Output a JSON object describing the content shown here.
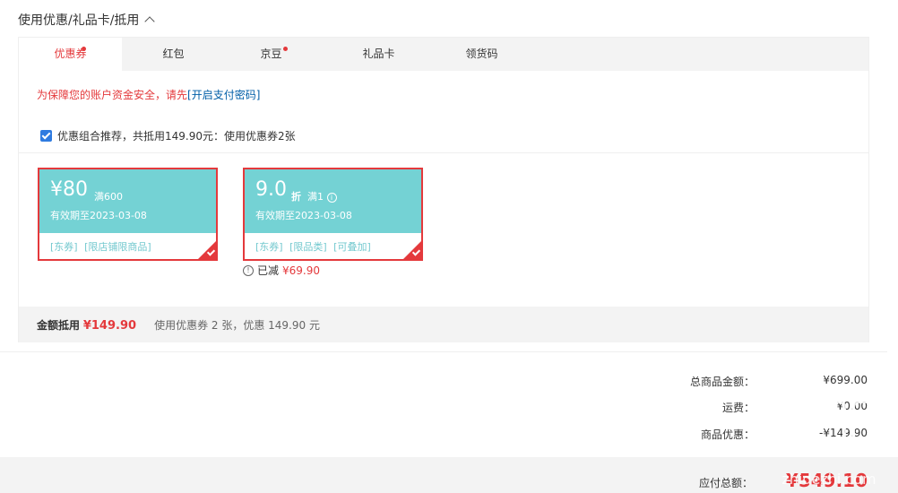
{
  "section": {
    "title": "使用优惠/礼品卡/抵用"
  },
  "tabs": [
    {
      "label": "优惠券",
      "active": true,
      "dot": true
    },
    {
      "label": "红包",
      "active": false,
      "dot": false
    },
    {
      "label": "京豆",
      "active": false,
      "dot": true
    },
    {
      "label": "礼品卡",
      "active": false,
      "dot": false
    },
    {
      "label": "领货码",
      "active": false,
      "dot": false
    }
  ],
  "security_notice": {
    "text": "为保障您的账户资金安全，请先",
    "link": "[开启支付密码]"
  },
  "combo": {
    "checked": true,
    "label": "优惠组合推荐，共抵用149.90元：使用优惠券2张"
  },
  "coupons": [
    {
      "amount": "¥80",
      "condition": "满600",
      "validity": "有效期至2023-03-08",
      "tags": "[东券] [限店铺限商品]"
    },
    {
      "amount": "9.0",
      "unit": "折",
      "condition": "满1",
      "validity": "有效期至2023-03-08",
      "tags": "[东券] [限品类] [可叠加]"
    }
  ],
  "reduced": {
    "label": "已减",
    "value": "¥69.90"
  },
  "summary": {
    "label": "金额抵用",
    "price": "¥149.90",
    "desc": "使用优惠券 2 张，优惠 149.90 元"
  },
  "totals": [
    {
      "label": "总商品金额：",
      "value": "¥699.00"
    },
    {
      "label": "运费：",
      "value": "¥0.00"
    },
    {
      "label": "商品优惠：",
      "value": "-¥149.90"
    }
  ],
  "payable": {
    "label": "应付总额：",
    "value": "¥549.10"
  },
  "colors": {
    "accent": "#e4393c",
    "coupon_bg": "#74d2d4",
    "link": "#005ea7"
  },
  "watermark": "zhidezhi.com"
}
